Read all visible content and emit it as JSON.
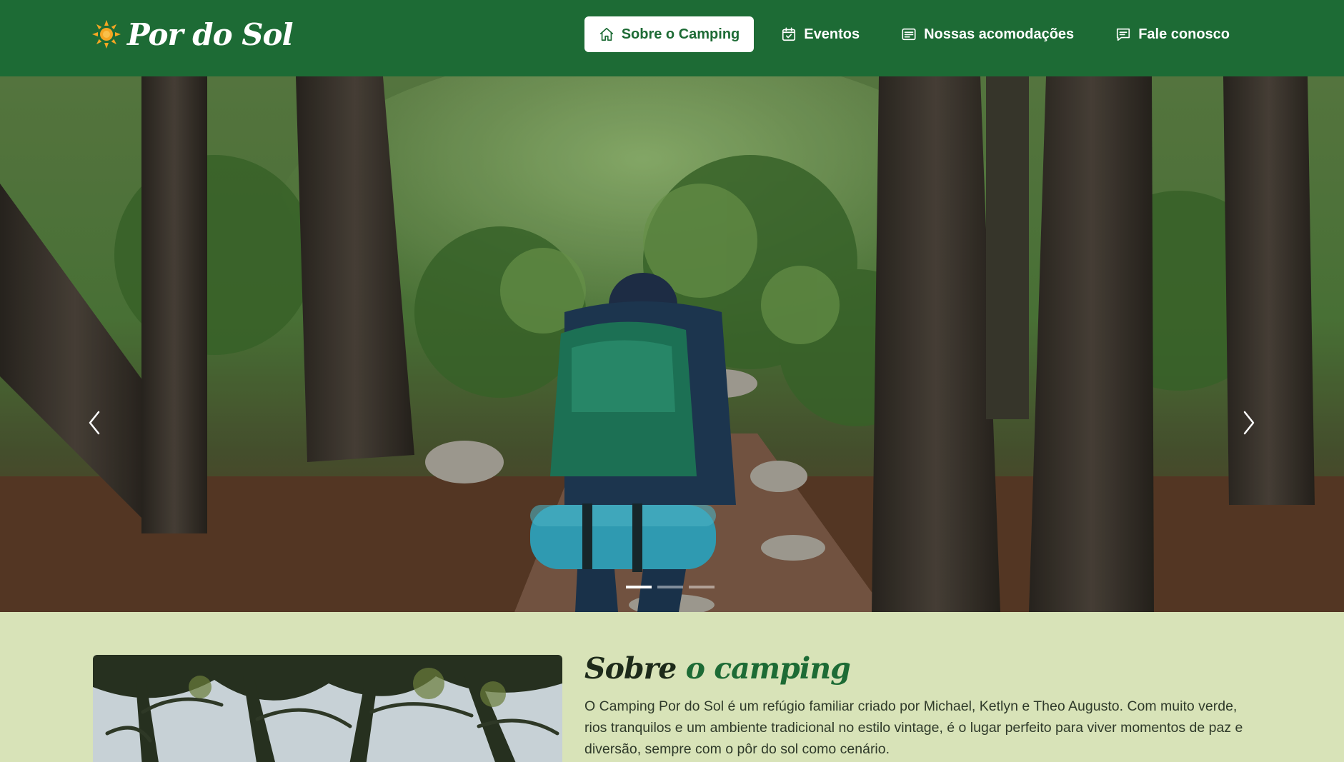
{
  "brand": {
    "name": "Por do Sol",
    "icon": "sun-icon",
    "icon_color": "#f5a623"
  },
  "nav": {
    "items": [
      {
        "label": "Sobre o Camping",
        "icon": "home-icon",
        "active": true
      },
      {
        "label": "Eventos",
        "icon": "calendar-check-icon",
        "active": false
      },
      {
        "label": "Nossas acomodações",
        "icon": "list-card-icon",
        "active": false
      },
      {
        "label": "Fale conosco",
        "icon": "chat-icon",
        "active": false
      }
    ]
  },
  "hero": {
    "image": "forest-hiker-backpack-photo",
    "prev_icon": "chevron-left-icon",
    "next_icon": "chevron-right-icon",
    "slide_count": 3,
    "active_slide": 1
  },
  "about": {
    "image": "trees-canopy-photo",
    "title_prefix": "Sobre",
    "title_accent": "o camping",
    "body": "O Camping Por do Sol é um refúgio familiar criado por Michael, Ketlyn e Theo Augusto. Com muito verde, rios tranquilos e um ambiente tradicional no estilo vintage, é o lugar perfeito para viver momentos de paz e diversão, sempre com o pôr do sol como cenário."
  },
  "colors": {
    "header_bg": "#1d6b35",
    "page_bg": "#d8e3b8",
    "accent": "#1d6b35",
    "sun": "#f5a623"
  }
}
